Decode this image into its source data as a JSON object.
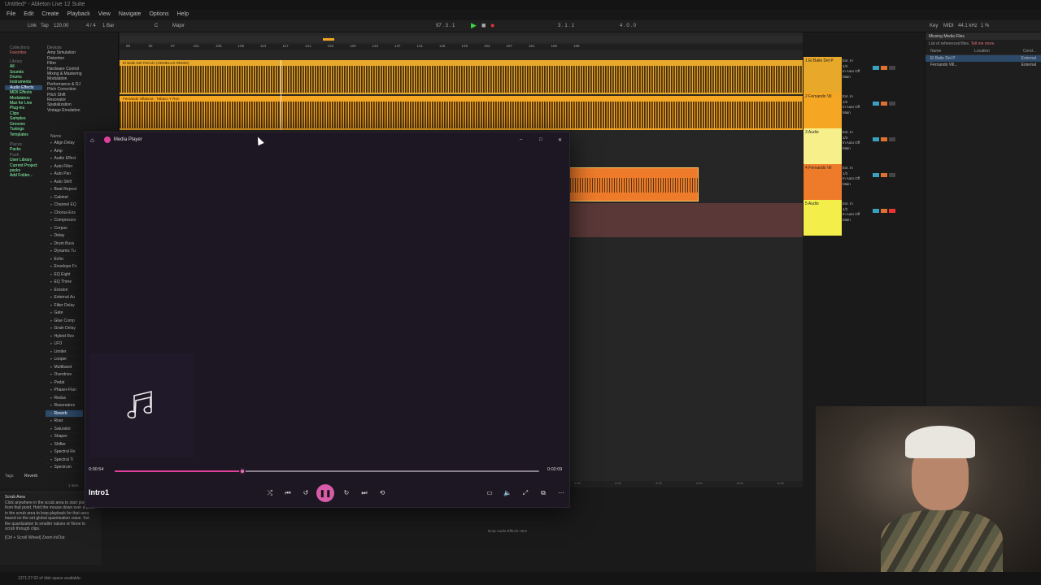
{
  "window": {
    "title": "Untitled* - Ableton Live 12 Suite"
  },
  "menu": [
    "File",
    "Edit",
    "Create",
    "Playback",
    "View",
    "Navigate",
    "Options",
    "Help"
  ],
  "control_bar": {
    "link": "Link",
    "tap": "Tap",
    "tempo": "120.00",
    "time_sig": "4 / 4",
    "quantize": "1 Bar",
    "key": "C",
    "scale": "Major",
    "position": "97 . 3 . 1",
    "loop_start": "3 . 1 . 1",
    "loop_length": "4 . 0 . 0",
    "key_map": "Key",
    "midi_map": "MIDI",
    "sample_rate": "44.1 kHz",
    "cpu": "1 %"
  },
  "browser": {
    "collections_label": "Collections",
    "favorites": "Favorites",
    "library_label": "Library",
    "categories": [
      "All",
      "Sounds",
      "Drums",
      "Instruments",
      "Audio Effects",
      "MIDI Effects",
      "Modulators",
      "Max for Live",
      "Plug-ins",
      "Clips",
      "Samples",
      "Grooves",
      "Tunings",
      "Templates"
    ],
    "places_label": "Places",
    "places": [
      "Packs",
      "Push",
      "User Library",
      "Current Project",
      "packs",
      "Add Folder..."
    ],
    "devices_label": "Devices",
    "filters": [
      "Amp Simulation",
      "Delay",
      "Distortion",
      "Dynamics",
      "EQ",
      "Filter",
      "Guitar",
      "Hardware Control",
      "Looping",
      "Mixing & Mastering",
      "Modulation",
      "Modulator",
      "Performance & DJ",
      "Pitch Correction",
      "Pitch Shift",
      "Racks",
      "Resonator",
      "Reverb",
      "Spatialization",
      "Utility",
      "Vintage Emulation",
      "Vocal"
    ],
    "name_header": "Name",
    "devices": [
      "Align Delay",
      "Amp",
      "Audio Effect",
      "Auto Filter",
      "Auto Pan",
      "Auto Shift",
      "Beat Repeat",
      "Cabinet",
      "Channel EQ",
      "Chorus-Ens",
      "Compressor",
      "Corpus",
      "Delay",
      "Drum Buss",
      "Dynamic Tu",
      "Echo",
      "Envelope Fo",
      "EQ Eight",
      "EQ Three",
      "Erosion",
      "External Au",
      "Filter Delay",
      "Gate",
      "Glue Comp",
      "Grain Delay",
      "Hybrid Rev",
      "LFO",
      "Limiter",
      "Looper",
      "Multiband",
      "Overdrive",
      "Pedal",
      "Phaser-Flan",
      "Redux",
      "Resonators",
      "Reverb",
      "Roar",
      "Saturator",
      "Shaper",
      "Shifter",
      "Spectral Re",
      "Spectral Ti",
      "Spectrum"
    ],
    "selected_device": "Reverb",
    "tags_label": "Tags",
    "tags_value": "Reverb",
    "item_count": "1 Item"
  },
  "info": {
    "title": "Scrub Area",
    "text": "Click anywhere in the scrub area to start playback from that point. Hold the mouse down over a point in the scrub area to loop playback for that area based on the set global quantization value. Set the quantization to smaller values or None to scrub through clips.",
    "shortcut": "[Ctrl + Scroll Wheel] Zoom In/Out"
  },
  "status": {
    "text": "1371:27:02 of disk space available."
  },
  "arrangement": {
    "ruler": [
      "89",
      "93",
      "97",
      "101",
      "105",
      "109",
      "113",
      "117",
      "121",
      "125",
      "129",
      "133",
      "137",
      "141",
      "145",
      "149",
      "153",
      "157",
      "161",
      "165",
      "169"
    ],
    "clips": [
      {
        "name": "El Baile Del Pericón (GEMELUS REMIX)"
      },
      {
        "name": "Fernando Villalona - Tabaco Y Ron"
      }
    ],
    "lower_ruler": [
      "1:00",
      "2:00",
      "3:00",
      "4:00",
      "5:00",
      "6:00"
    ],
    "drop_effects": "Drop Audio Effects Here",
    "set_label": "Set"
  },
  "mixer": {
    "tracks": [
      {
        "name": "1 El Baile Del P",
        "input": "Ext. In",
        "channel": "1/2",
        "monitor": "In Auto Off",
        "output": "Main",
        "color": "#e8a82a"
      },
      {
        "name": "2 Fernando Vil",
        "input": "Ext. In",
        "channel": "1/2",
        "monitor": "In Auto Off",
        "output": "Main",
        "color": "#f5a623"
      },
      {
        "name": "3 Audio",
        "input": "Ext. In",
        "channel": "1/2",
        "monitor": "In Auto Off",
        "output": "Main",
        "color": "#f7f08a"
      },
      {
        "name": "4 Fernando Vil",
        "input": "Ext. In",
        "channel": "1/2",
        "monitor": "In Auto Off",
        "output": "Main",
        "color": "#ee7b2a"
      },
      {
        "name": "5 Audio",
        "input": "Ext. In",
        "channel": "1/2",
        "monitor": "In Auto Off",
        "output": "Main",
        "color": "#f3ee4a"
      }
    ]
  },
  "references": {
    "header": "Missing Media Files",
    "subheader": "List of referenced files.",
    "tell_more": "Tell me more.",
    "col_name": "Name",
    "col_location": "Location",
    "col_cond": "Cond...",
    "rows": [
      {
        "name": "El Baile Del P",
        "location": "External"
      },
      {
        "name": "Fernando Vill...",
        "location": "External"
      }
    ]
  },
  "media_player": {
    "title": "Media Player",
    "current_time": "0:00:54",
    "total_time": "0:02:09",
    "progress": 0.3,
    "track_title": "Intro1",
    "accent": "#e0409a"
  }
}
